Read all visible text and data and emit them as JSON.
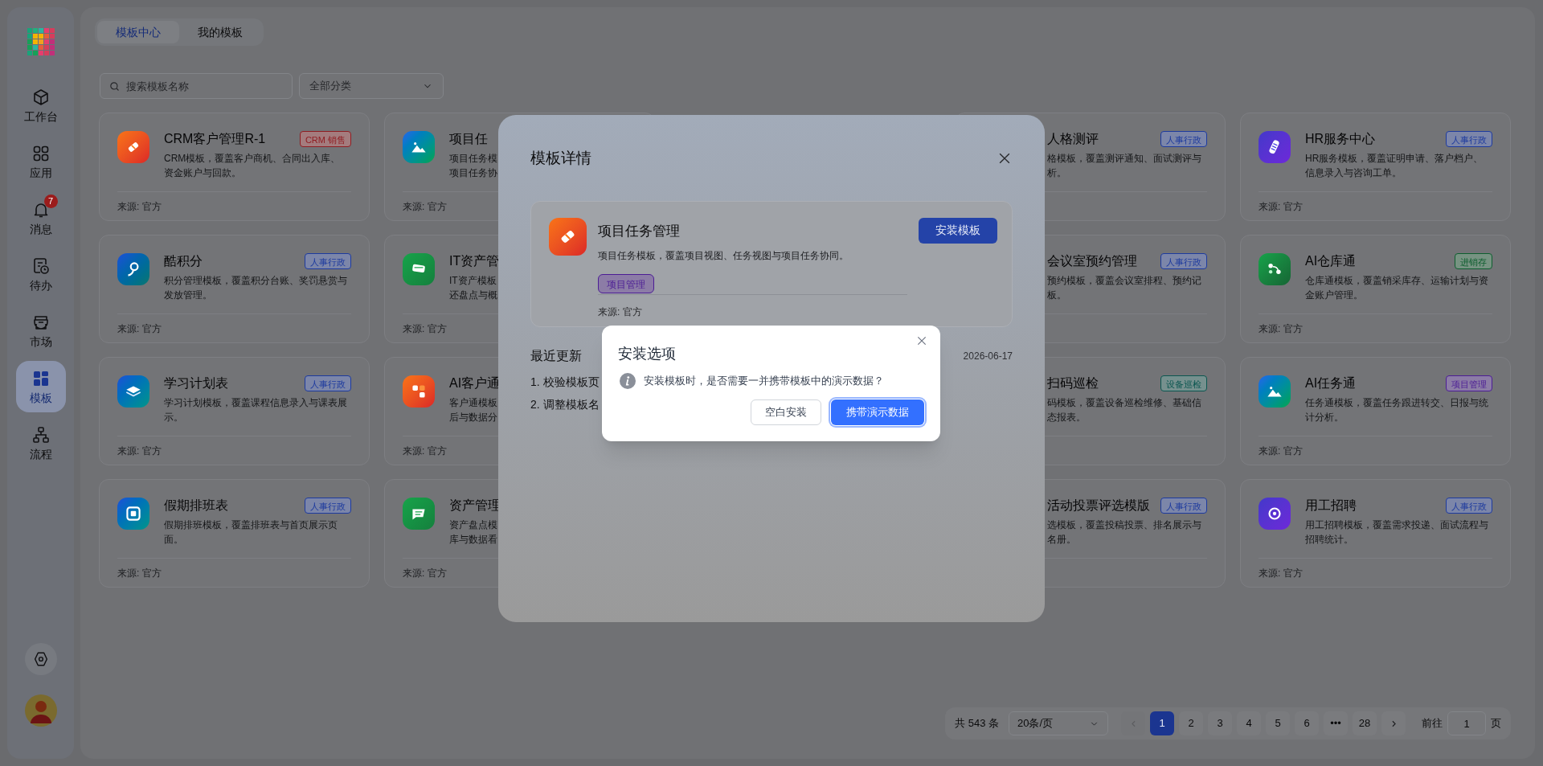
{
  "sidebar": {
    "nav_items": [
      {
        "label": "工作台",
        "selected": false
      },
      {
        "label": "应用",
        "selected": false
      },
      {
        "label": "消息",
        "selected": false,
        "badge": "7"
      },
      {
        "label": "待办",
        "selected": false
      },
      {
        "label": "市场",
        "selected": false
      },
      {
        "label": "模板",
        "selected": true
      },
      {
        "label": "流程",
        "selected": false
      }
    ]
  },
  "tabs": [
    {
      "label": "模板中心",
      "selected": true
    },
    {
      "label": "我的模板",
      "selected": false
    }
  ],
  "search": {
    "placeholder": "搜索模板名称"
  },
  "category_select": {
    "placeholder": "全部分类"
  },
  "card_rows": [
    [
      {
        "kind": "full",
        "title": "CRM客户管理R-1",
        "tag": {
          "label": "CRM 销售",
          "color": "#8f1d22"
        },
        "description": "CRM模板，覆盖客户商机、合同出入库、资金账户与回款。",
        "source": "来源: 官方"
      },
      {
        "kind": "left_edge",
        "title": "项目任",
        "description_lines": [
          "项目任务模",
          "项目任务协"
        ],
        "source": "来源: 官方"
      },
      {
        "kind": "right_edge",
        "title": "人格测评",
        "tag": {
          "label": "人事行政",
          "color": "#1d3a9e"
        },
        "description_lines": [
          "格模板，覆盖测评通知、面试测评与",
          "析。"
        ]
      },
      {
        "kind": "full",
        "title": "HR服务中心",
        "tag": {
          "label": "人事行政",
          "color": "#1d3a9e"
        },
        "description": "HR服务模板，覆盖证明申请、落户档户、信息录入与咨询工单。",
        "source": "来源: 官方"
      }
    ],
    [
      {
        "kind": "full",
        "title": "酷积分",
        "tag": {
          "label": "人事行政",
          "color": "#1d3a9e"
        },
        "description": "积分管理模板，覆盖积分台账、奖罚悬赏与发放管理。",
        "source": "来源: 官方"
      },
      {
        "kind": "left_edge",
        "title": "IT资产管",
        "description_lines": [
          "IT资产模板",
          "还盘点与概"
        ],
        "source": "来源: 官方"
      },
      {
        "kind": "right_edge",
        "title": "会议室预约管理",
        "tag": {
          "label": "人事行政",
          "color": "#1d3a9e"
        },
        "description_lines": [
          "预约模板，覆盖会议室排程、预约记",
          "板。"
        ]
      },
      {
        "kind": "full",
        "title": "AI仓库通",
        "tag": {
          "label": "进销存",
          "color": "#0e5e2f"
        },
        "description": "仓库通模板，覆盖销采库存、运输计划与资金账户管理。",
        "source": "来源: 官方"
      }
    ],
    [
      {
        "kind": "full",
        "title": "学习计划表",
        "tag": {
          "label": "人事行政",
          "color": "#1d3a9e"
        },
        "description": "学习计划模板，覆盖课程信息录入与课表展示。",
        "source": "来源: 官方"
      },
      {
        "kind": "left_edge",
        "title": "AI客户通",
        "description_lines": [
          "客户通模板",
          "后与数据分"
        ],
        "source": "来源: 官方"
      },
      {
        "kind": "right_edge",
        "title": "扫码巡检",
        "tag": {
          "label": "设备巡检",
          "color": "#0b5650"
        },
        "description_lines": [
          "码模板，覆盖设备巡检维修、基础信",
          "态报表。"
        ]
      },
      {
        "kind": "full",
        "title": "AI任务通",
        "tag": {
          "label": "项目管理",
          "color": "#4c1d95"
        },
        "description": "任务通模板，覆盖任务跟进转交、日报与统计分析。",
        "source": "来源: 官方"
      }
    ],
    [
      {
        "kind": "full",
        "title": "假期排班表",
        "tag": {
          "label": "人事行政",
          "color": "#1d3a9e"
        },
        "description": "假期排班模板，覆盖排班表与首页展示页面。",
        "source": "来源: 官方"
      },
      {
        "kind": "left_edge",
        "title": "资产管理",
        "description_lines": [
          "资产盘点模",
          "库与数据看"
        ],
        "source": "来源: 官方"
      },
      {
        "kind": "right_edge",
        "title": "活动投票评选模版",
        "tag": {
          "label": "人事行政",
          "color": "#1d3a9e"
        },
        "description_lines": [
          "选模板，覆盖投稿投票、排名展示与",
          "名册。"
        ]
      },
      {
        "kind": "full",
        "title": "用工招聘",
        "tag": {
          "label": "人事行政",
          "color": "#1d3a9e"
        },
        "description": "用工招聘模板，覆盖需求投递、面试流程与招聘统计。",
        "source": "来源: 官方"
      }
    ]
  ],
  "pagination": {
    "total": "共 543 条",
    "page_size": "20条/页",
    "prev": {
      "disabled": true
    },
    "next": {
      "disabled": false
    },
    "pages": [
      {
        "label": "1",
        "selected": true
      },
      {
        "label": "2",
        "selected": false
      },
      {
        "label": "3",
        "selected": false
      },
      {
        "label": "4",
        "selected": false
      },
      {
        "label": "5",
        "selected": false
      },
      {
        "label": "6",
        "selected": false
      },
      {
        "label": "•••",
        "selected": false
      },
      {
        "label": "28",
        "selected": false
      }
    ],
    "goto_label": "前往",
    "goto_value": "1",
    "page_unit": "页"
  },
  "detail_modal": {
    "title": "模板详情",
    "template": {
      "name": "项目任务管理",
      "description": "项目任务模板，覆盖项目视图、任务视图与项目任务协同。",
      "tag": {
        "label": "项目管理",
        "color": "#4c1d95"
      },
      "source": "来源: 官方"
    },
    "install_button": "安装模板",
    "recent_updates": {
      "heading": "最近更新",
      "date": "2026-06-17",
      "items": [
        "1. 校验模板页",
        "2. 调整模板名"
      ]
    }
  },
  "install_dialog": {
    "title": "安装选项",
    "message": "安装模板时，是否需要一并携带模板中的演示数据？",
    "buttons": [
      {
        "label": "空白安装",
        "kind": "secondary"
      },
      {
        "label": "携带演示数据",
        "kind": "primary"
      }
    ]
  }
}
